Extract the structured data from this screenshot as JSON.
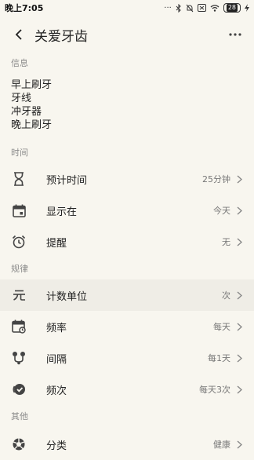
{
  "status_bar": {
    "time": "晚上7:05",
    "battery": "28"
  },
  "app_bar": {
    "title": "关爱牙齿"
  },
  "info": {
    "header": "信息",
    "lines": [
      "早上刷牙",
      "牙线",
      "冲牙器",
      "晚上刷牙"
    ]
  },
  "time_section": {
    "header": "时间",
    "rows": [
      {
        "label": "预计时间",
        "value": "25分钟",
        "icon": "hourglass-icon"
      },
      {
        "label": "显示在",
        "value": "今天",
        "icon": "calendar-icon"
      },
      {
        "label": "提醒",
        "value": "无",
        "icon": "alarm-clock-icon"
      }
    ]
  },
  "rule_section": {
    "header": "规律",
    "rows": [
      {
        "label": "计数单位",
        "value": "次",
        "icon": "yuan-unit-icon"
      },
      {
        "label": "频率",
        "value": "每天",
        "icon": "calendar-repeat-icon"
      },
      {
        "label": "间隔",
        "value": "每1天",
        "icon": "interval-route-icon"
      },
      {
        "label": "频次",
        "value": "每天3次",
        "icon": "check-badge-icon"
      }
    ]
  },
  "other_section": {
    "header": "其他",
    "rows": [
      {
        "label": "分类",
        "value": "健康",
        "icon": "category-aperture-icon"
      }
    ]
  }
}
